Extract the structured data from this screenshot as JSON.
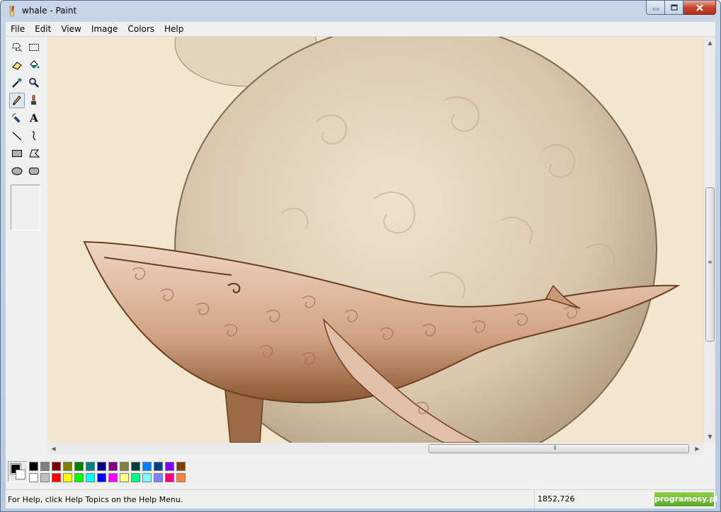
{
  "window": {
    "title": "whale - Paint"
  },
  "menu": [
    "File",
    "Edit",
    "View",
    "Image",
    "Colors",
    "Help"
  ],
  "tools": [
    {
      "name": "free-form-select-icon",
      "active": false
    },
    {
      "name": "select-icon",
      "active": false
    },
    {
      "name": "eraser-icon",
      "active": false
    },
    {
      "name": "fill-with-color-icon",
      "active": false
    },
    {
      "name": "pick-color-icon",
      "active": false
    },
    {
      "name": "magnifier-icon",
      "active": false
    },
    {
      "name": "pencil-icon",
      "active": true
    },
    {
      "name": "brush-icon",
      "active": false
    },
    {
      "name": "airbrush-icon",
      "active": false
    },
    {
      "name": "text-icon",
      "active": false
    },
    {
      "name": "line-icon",
      "active": false
    },
    {
      "name": "curve-icon",
      "active": false
    },
    {
      "name": "rectangle-icon",
      "active": false
    },
    {
      "name": "polygon-icon",
      "active": false
    },
    {
      "name": "ellipse-icon",
      "active": false
    },
    {
      "name": "rounded-rectangle-icon",
      "active": false
    }
  ],
  "text_tool_glyph": "A",
  "palette": {
    "foreground": "#000000",
    "background": "#ffffff",
    "top_row": [
      "#000000",
      "#808080",
      "#800000",
      "#808000",
      "#008000",
      "#008080",
      "#000080",
      "#800080",
      "#808040",
      "#004040",
      "#0080ff",
      "#004080",
      "#8000ff",
      "#804000"
    ],
    "bottom_row": [
      "#ffffff",
      "#c0c0c0",
      "#ff0000",
      "#ffff00",
      "#00ff00",
      "#00ffff",
      "#0000ff",
      "#ff00ff",
      "#ffff80",
      "#00ff80",
      "#80ffff",
      "#8080ff",
      "#ff0080",
      "#ff8040"
    ]
  },
  "status": {
    "help_text": "For Help, click Help Topics on the Help Menu.",
    "coords": "1852,726",
    "brand": "programosy.pl"
  }
}
